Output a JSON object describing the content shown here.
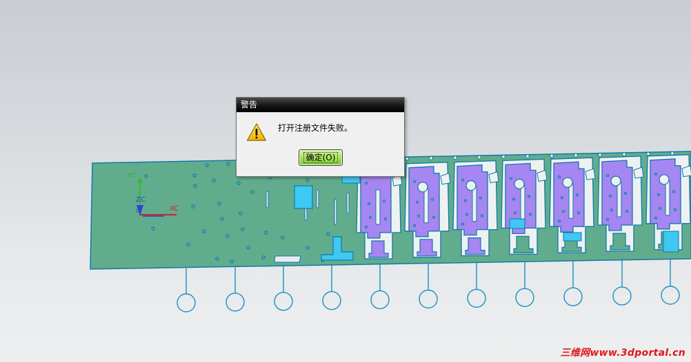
{
  "viewport": {
    "axis_labels": {
      "y": "YC",
      "z": "ZC",
      "x": "XC"
    },
    "colors": {
      "strip": "#62ac8e",
      "outline": "#0f79a6",
      "part_purple": "#a586f3",
      "part_cyan": "#3ec8f2",
      "leader": "#1a8fc4"
    }
  },
  "dialog": {
    "title": "警告",
    "icon": "warning-icon",
    "message": "打开注册文件失败。",
    "ok_label": "确定(O)"
  },
  "watermark": "三维网www.3dportal.cn"
}
